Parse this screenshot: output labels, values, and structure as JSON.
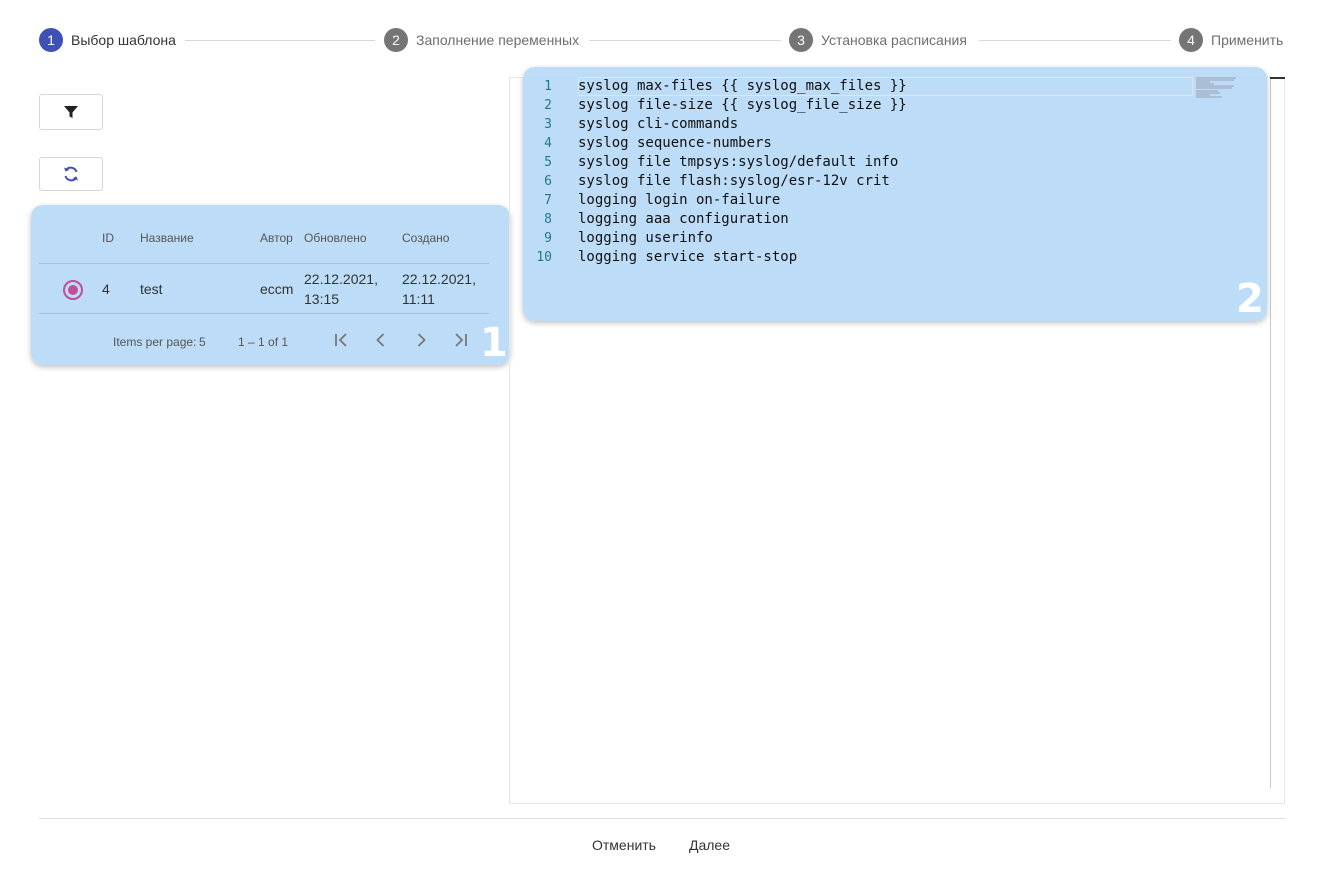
{
  "stepper": {
    "steps": [
      {
        "number": "1",
        "label": "Выбор шаблона",
        "active": true
      },
      {
        "number": "2",
        "label": "Заполнение переменных",
        "active": false
      },
      {
        "number": "3",
        "label": "Установка расписания",
        "active": false
      },
      {
        "number": "4",
        "label": "Применить",
        "active": false
      }
    ]
  },
  "toolbar": {
    "filter_icon": "filter-icon",
    "refresh_icon": "refresh-icon"
  },
  "table": {
    "headers": [
      "ID",
      "Название",
      "Автор",
      "Обновлено",
      "Создано"
    ],
    "rows": [
      {
        "selected": true,
        "id": "4",
        "name": "test",
        "author": "eccm",
        "updated": "22.12.2021,\n13:15",
        "updated_l1": "22.12.2021,",
        "updated_l2": "13:15",
        "created_l1": "22.12.2021,",
        "created_l2": "11:11"
      }
    ],
    "paginator": {
      "items_per_page_label": "Items per page:",
      "items_per_page_value": "5",
      "range_label": "1 – 1 of 1"
    }
  },
  "highlights": {
    "table_marker": "1",
    "editor_marker": "2"
  },
  "editor": {
    "lines": [
      {
        "n": "1",
        "text": "syslog max-files {{ syslog_max_files }}"
      },
      {
        "n": "2",
        "text": "syslog file-size {{ syslog_file_size }}"
      },
      {
        "n": "3",
        "text": "syslog cli-commands"
      },
      {
        "n": "4",
        "text": "syslog sequence-numbers"
      },
      {
        "n": "5",
        "text": "syslog file tmpsys:syslog/default info"
      },
      {
        "n": "6",
        "text": "syslog file flash:syslog/esr-12v crit"
      },
      {
        "n": "7",
        "text": "logging login on-failure"
      },
      {
        "n": "8",
        "text": "logging aaa configuration"
      },
      {
        "n": "9",
        "text": "logging userinfo"
      },
      {
        "n": "10",
        "text": "logging service start-stop"
      }
    ]
  },
  "footer": {
    "cancel_label": "Отменить",
    "next_label": "Далее"
  },
  "colors": {
    "accent": "#3f51b5",
    "radio": "#c04e9c",
    "highlight": "#b2d6f6"
  }
}
